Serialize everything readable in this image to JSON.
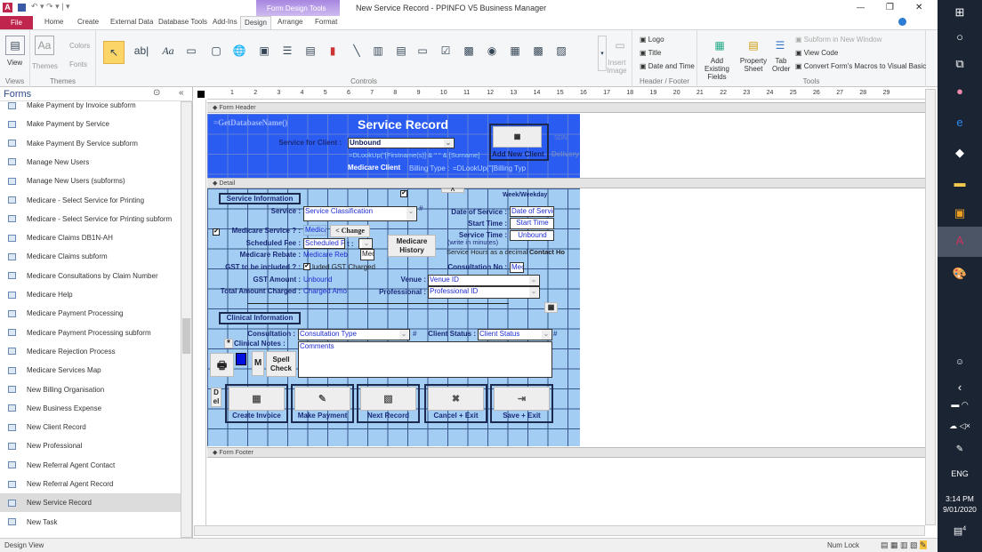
{
  "window": {
    "title": "New Service Record  -  PPINFO V5 Business Manager",
    "context_tab": "Form Design Tools",
    "minimize": "—",
    "restore": "❐",
    "close": "✕"
  },
  "tabs": [
    "File",
    "Home",
    "Create",
    "External Data",
    "Database Tools",
    "Add-Ins",
    "Design",
    "Arrange",
    "Format"
  ],
  "active_tab": "Design",
  "ribbon": {
    "views": {
      "label": "Views",
      "view": "View"
    },
    "themes": {
      "label": "Themes",
      "themes": "Themes",
      "colors": "Colors",
      "fonts": "Fonts"
    },
    "controls": {
      "label": "Controls",
      "insert_image": "Insert Image"
    },
    "header_footer": {
      "label": "Header / Footer",
      "logo": "Logo",
      "title": "Title",
      "date_time": "Date and Time"
    },
    "tools": {
      "label": "Tools",
      "add_fields": "Add Existing Fields",
      "property_sheet": "Property Sheet",
      "tab_order": "Tab Order",
      "subform": "Subform in New Window",
      "view_code": "View Code",
      "convert": "Convert Form's Macros to Visual Basic"
    }
  },
  "nav": {
    "title": "Forms",
    "items": [
      "Make Payment by Invoice subform",
      "Make Payment by Service",
      "Make Payment By Service subform",
      "Manage New Users",
      "Manage New Users (subforms)",
      "Medicare - Select Service for Printing",
      "Medicare - Select Service for Printing subform",
      "Medicare Claims DB1N-AH",
      "Medicare Claims subform",
      "Medicare Consultations by Claim Number",
      "Medicare Help",
      "Medicare Payment Processing",
      "Medicare Payment Processing subform",
      "Medicare Rejection Process",
      "Medicare Services Map",
      "New Billing Organisation",
      "New Business Expense",
      "New Client Record",
      "New Professional",
      "New Referral Agent Contact",
      "New Referral Agent Record",
      "New Service Record",
      "New Task"
    ],
    "selected": "New Service Record"
  },
  "sections": {
    "header": "Form Header",
    "detail": "Detail",
    "footer": "Form Footer"
  },
  "ruler": [
    "1",
    "2",
    "3",
    "4",
    "5",
    "6",
    "7",
    "8",
    "9",
    "10",
    "11",
    "12",
    "13",
    "14",
    "15",
    "16",
    "17",
    "18",
    "19",
    "20",
    "21",
    "22",
    "23",
    "24",
    "25",
    "26",
    "27",
    "28",
    "29"
  ],
  "form_header": {
    "db_name": "=GetDatabaseName()",
    "title": "Service Record",
    "client_label": "Service for Client :",
    "client_value": "Unbound",
    "name_expr": "=DLookUp(\"[Firstname(s)] & \" \" & [Surname]",
    "medicare_client": "Medicare Client",
    "billing_label": "Billing Type :",
    "billing_expr": "=DLookUp(\"[Billing Typ",
    "add_client": "Add New Client",
    "sdn": "SDN",
    "delivery": "Delivery"
  },
  "detail": {
    "service_info": "Service Information",
    "week": "Week/Weekday",
    "service_label": "Service :",
    "service_value": "Service Classification",
    "date_label": "Date of Service :",
    "date_value": "Date of Servic",
    "start_label": "Start Time :",
    "start_value": "Start Time",
    "stime_label": "Service Time :",
    "stime_value": "Unbound",
    "medicare_service_label": "Medicare Service ? :",
    "medicare_service_value": "Medica",
    "change": "< Change",
    "medicare_history": "Medicare History",
    "fee_label": "Scheduled Fee :",
    "fee_value": "Scheduled Fe",
    "t_label": "t :",
    "minutes": "(write in minutes)",
    "rebate_label": "Medicare Rebate :",
    "rebate_value": "Medicare Reb",
    "mec": "Mec",
    "hours": "Service Hours as a decimal",
    "contact": "Contact Ho",
    "gst_label": "GST to be included ? :",
    "gst_value": "luded GST Charged",
    "consult_no_label": "Consultation No :",
    "consult_no_value": "Mec",
    "gst_amount_label": "GST Amount :",
    "gst_amount_value": "Unbound",
    "venue_label": "Venue :",
    "venue_value": "Venue ID",
    "total_label": "Total Amount Charged :",
    "total_value": "Charged Amo",
    "professional_label": "Professional :",
    "professional_value": "Professional ID",
    "clinical_info": "Clinical Information",
    "consultation_label": "Consultation :",
    "consultation_value": "Consultation Type",
    "hash": "#",
    "client_status_label": "Client Status :",
    "client_status_value": "Client Status",
    "notes_label": "Clinical Notes :",
    "notes_value": "Comments",
    "star": "*",
    "m": "M",
    "spell": "Spell Check",
    "del": "D el",
    "buttons": [
      "Create Invoice",
      "Make Payment",
      "Next Record",
      "Cancel + Exit",
      "Save + Exit"
    ]
  },
  "status": {
    "left": "Design View",
    "num_lock": "Num Lock"
  },
  "taskbar": {
    "lang": "ENG",
    "time": "3:14 PM",
    "date": "9/01/2020",
    "notifications": "4"
  },
  "colors": {
    "header_bg": "#2b5cf2",
    "detail_bg": "#a4cdf4",
    "file_tab": "#c0254e",
    "context_tab": "#9b73d8"
  }
}
